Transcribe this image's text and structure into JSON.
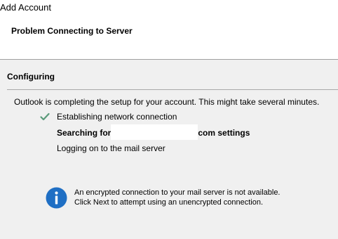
{
  "window": {
    "title": "Add Account"
  },
  "header": {
    "heading": "Problem Connecting to Server"
  },
  "section": {
    "title": "Configuring",
    "status": "Outlook is completing the setup for your account. This might take several minutes."
  },
  "steps": [
    {
      "label": "Establishing network connection",
      "icon": "check-icon",
      "state": "done"
    },
    {
      "prefix": "Searching for",
      "suffix": "com settings",
      "state": "in-progress"
    },
    {
      "label": "Logging on to the mail server",
      "state": "pending"
    }
  ],
  "info": {
    "icon": "info-icon",
    "line1": "An encrypted connection to your mail server is not available.",
    "line2": "Click Next to attempt using an unencrypted connection."
  },
  "colors": {
    "check": "#5a9a7a",
    "info": "#1f6fc4",
    "panel": "#f0f0f0"
  }
}
